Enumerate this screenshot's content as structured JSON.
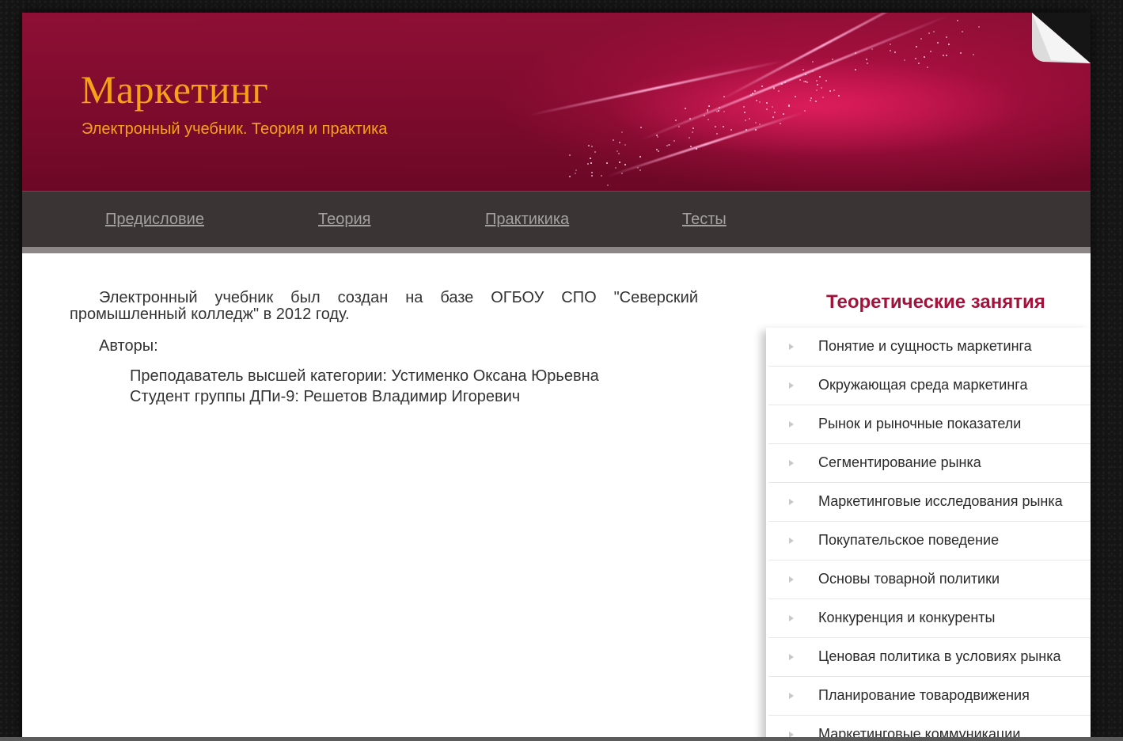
{
  "header": {
    "title": "Маркетинг",
    "subtitle": "Электронный учебник. Теория и практика"
  },
  "nav": {
    "items": [
      {
        "label": "Предисловие"
      },
      {
        "label": "Теория"
      },
      {
        "label": "Практикика"
      },
      {
        "label": "Тесты"
      }
    ]
  },
  "main": {
    "intro": "Электронный учебник был создан на базе ОГБОУ СПО \"Северский промышленный колледж\" в 2012 году.",
    "authors_label": "Авторы:",
    "authors": [
      "Преподаватель высшей категории: Устименко Оксана Юрьевна",
      "Студент группы ДПи-9: Решетов Владимир Игоревич"
    ]
  },
  "sidebar": {
    "title": "Теоретические занятия",
    "items": [
      {
        "label": "Понятие и сущность маркетинга"
      },
      {
        "label": "Окружающая среда маркетинга"
      },
      {
        "label": "Рынок и рыночные показатели"
      },
      {
        "label": "Сегментирование рынка"
      },
      {
        "label": "Маркетинговые исследования рынка"
      },
      {
        "label": "Покупательское поведение"
      },
      {
        "label": "Основы товарной политики"
      },
      {
        "label": "Конкуренция и конкуренты"
      },
      {
        "label": "Ценовая политика в условиях рынка"
      },
      {
        "label": "Планирование товародвижения"
      },
      {
        "label": "Маркетинговые коммуникации"
      }
    ]
  },
  "colors": {
    "header_bg": "#7d0b2d",
    "title_accent": "#f6a219",
    "navbar_bg": "#3a3434",
    "sidebar_title": "#a3123a"
  }
}
